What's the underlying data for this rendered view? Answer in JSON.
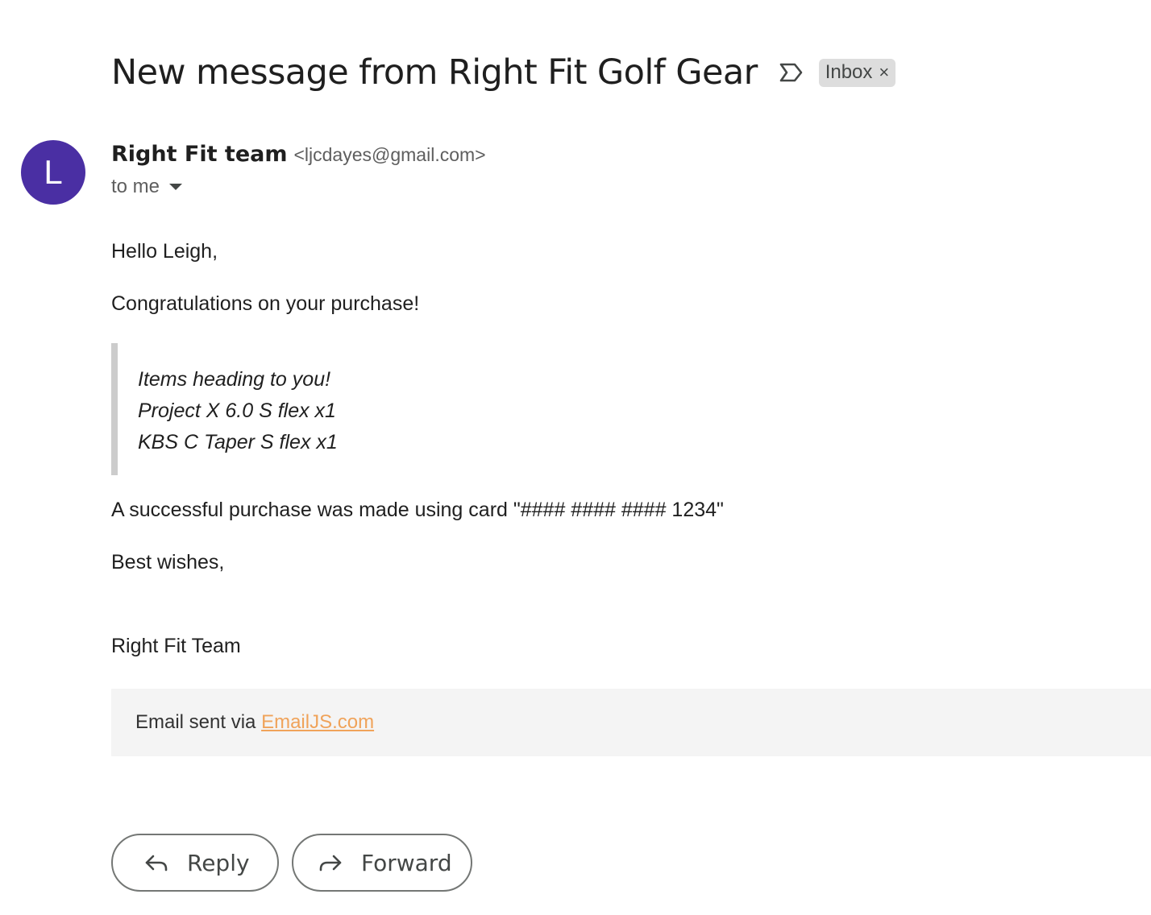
{
  "subject": {
    "title": "New message from Right Fit Golf Gear",
    "label": "Inbox",
    "label_remove": "×"
  },
  "sender": {
    "avatar_letter": "L",
    "name": "Right Fit team",
    "email": "<ljcdayes@gmail.com>",
    "recipient": "to me"
  },
  "body": {
    "greeting": "Hello Leigh,",
    "intro": "Congratulations on your purchase!",
    "items": [
      "Items heading to you!",
      "Project X 6.0 S flex x1",
      "KBS C Taper S flex x1"
    ],
    "payment": "A successful purchase was made using card \"#### #### #### 1234\"",
    "signoff": "Best wishes,",
    "signature": "Right Fit Team"
  },
  "footer": {
    "prefix": "Email sent via ",
    "link": "EmailJS.com"
  },
  "actions": {
    "reply": "Reply",
    "forward": "Forward"
  },
  "colors": {
    "avatar": "#4a2fa3",
    "link": "#f0a35a",
    "chip": "#dddddd",
    "quote_bar": "#cccccc",
    "footer_bg": "#f4f4f4"
  }
}
